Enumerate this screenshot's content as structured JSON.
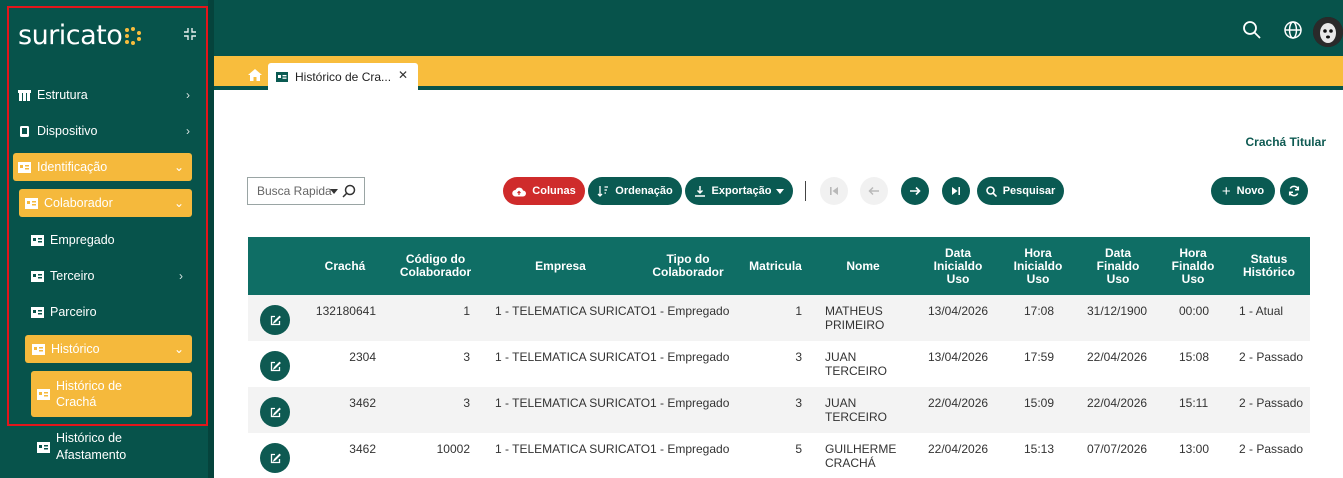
{
  "app": {
    "logo_text": "suricato",
    "brand_colors": {
      "primary": "#07534b",
      "accent": "#f8bd3d",
      "danger": "#cf2b2b"
    }
  },
  "sidebar": {
    "items": [
      {
        "label": "Estrutura",
        "icon": "building-icon",
        "has_chevron": true
      },
      {
        "label": "Dispositivo",
        "icon": "device-icon",
        "has_chevron": true
      },
      {
        "label": "Identificação",
        "icon": "id-card-icon",
        "has_chevron": true,
        "expanded": true
      },
      {
        "label": "Colaborador",
        "icon": "id-card-icon",
        "has_chevron": true,
        "expanded": true
      },
      {
        "label": "Empregado",
        "icon": "id-card-icon"
      },
      {
        "label": "Terceiro",
        "icon": "id-card-icon",
        "has_chevron": true
      },
      {
        "label": "Parceiro",
        "icon": "id-card-icon"
      },
      {
        "label": "Histórico",
        "icon": "id-card-icon",
        "has_chevron": true,
        "expanded": true
      },
      {
        "label": "Histórico de\nCrachá",
        "icon": "id-card-icon",
        "active": true
      },
      {
        "label": "Histórico de\nAfastamento",
        "icon": "id-card-icon"
      }
    ]
  },
  "tabs": [
    {
      "label": "Histórico de Cra...",
      "icon": "id-card-icon",
      "closable": true
    }
  ],
  "page": {
    "heading": "Crachá Titular"
  },
  "toolbar": {
    "search_placeholder": "Busca Rapida",
    "columns_label": "Colunas",
    "sort_label": "Ordenação",
    "export_label": "Exportação",
    "search_label": "Pesquisar",
    "new_label": "Novo"
  },
  "table": {
    "headers": [
      "Crachá",
      "Código do\nColaborador",
      "Empresa",
      "Tipo do\nColaborador",
      "Matricula",
      "Nome",
      "Data\nInicialdo\nUso",
      "Hora\nInicialdo\nUso",
      "Data\nFinaldo\nUso",
      "Hora\nFinaldo\nUso",
      "Status\nHistórico"
    ],
    "rows": [
      [
        "132180641",
        "1",
        "1 - TELEMATICA SURICATO",
        "1 - Empregado",
        "1",
        "MATHEUS\nPRIMEIRO",
        "13/04/2026",
        "17:08",
        "31/12/1900",
        "00:00",
        "1 - Atual"
      ],
      [
        "2304",
        "3",
        "1 - TELEMATICA SURICATO",
        "1 - Empregado",
        "3",
        "JUAN\nTERCEIRO",
        "13/04/2026",
        "17:59",
        "22/04/2026",
        "15:08",
        "2 - Passado"
      ],
      [
        "3462",
        "3",
        "1 - TELEMATICA SURICATO",
        "1 - Empregado",
        "3",
        "JUAN\nTERCEIRO",
        "22/04/2026",
        "15:09",
        "22/04/2026",
        "15:11",
        "2 - Passado"
      ],
      [
        "3462",
        "10002",
        "1 - TELEMATICA SURICATO",
        "1 - Empregado",
        "5",
        "GUILHERME\nCRACHÁ",
        "22/04/2026",
        "15:13",
        "07/07/2026",
        "13:00",
        "2 - Passado"
      ]
    ]
  }
}
